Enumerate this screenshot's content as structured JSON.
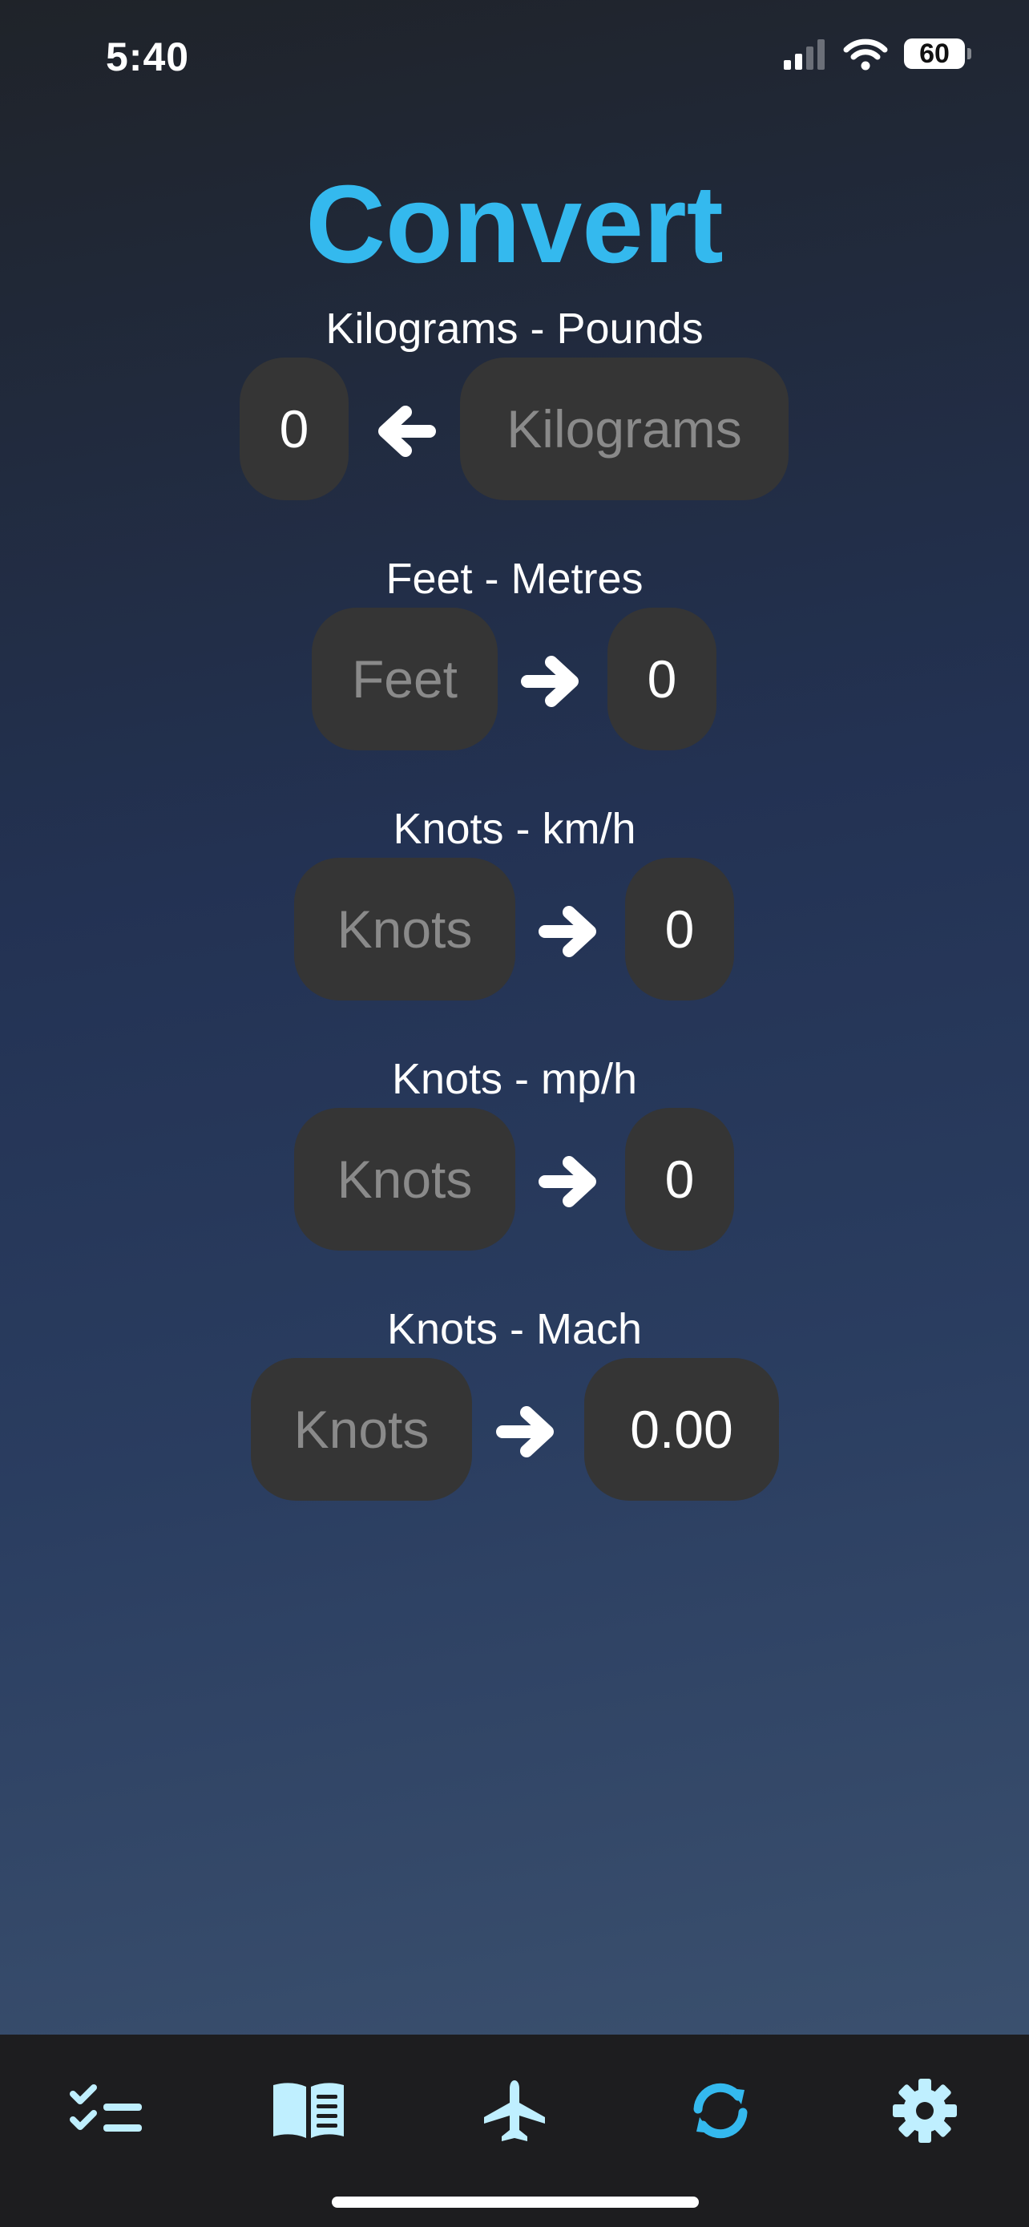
{
  "status_bar": {
    "time": "5:40",
    "battery_level": "60",
    "signal_icon": "cellular-signal-icon",
    "wifi_icon": "wifi-icon"
  },
  "title": "Convert",
  "colors": {
    "accent": "#34b9ee",
    "tab_icon": "#bfefff",
    "box_background": "#353535",
    "placeholder_text": "#8a8a8a"
  },
  "converters": [
    {
      "label": "Kilograms - Pounds",
      "input_placeholder": "Kilograms",
      "output_value": "0",
      "arrow_direction": "left"
    },
    {
      "label": "Feet - Metres",
      "input_placeholder": "Feet",
      "output_value": "0",
      "arrow_direction": "right"
    },
    {
      "label": "Knots - km/h",
      "input_placeholder": "Knots",
      "output_value": "0",
      "arrow_direction": "right"
    },
    {
      "label": "Knots - mp/h",
      "input_placeholder": "Knots",
      "output_value": "0",
      "arrow_direction": "right"
    },
    {
      "label": "Knots - Mach",
      "input_placeholder": "Knots",
      "output_value": "0.00",
      "arrow_direction": "right"
    }
  ],
  "tab_bar": {
    "tabs": [
      {
        "icon": "checklist-icon",
        "selected": false
      },
      {
        "icon": "book-icon",
        "selected": false
      },
      {
        "icon": "airplane-icon",
        "selected": false
      },
      {
        "icon": "convert-arrows-icon",
        "selected": true
      },
      {
        "icon": "gear-icon",
        "selected": false
      }
    ]
  }
}
